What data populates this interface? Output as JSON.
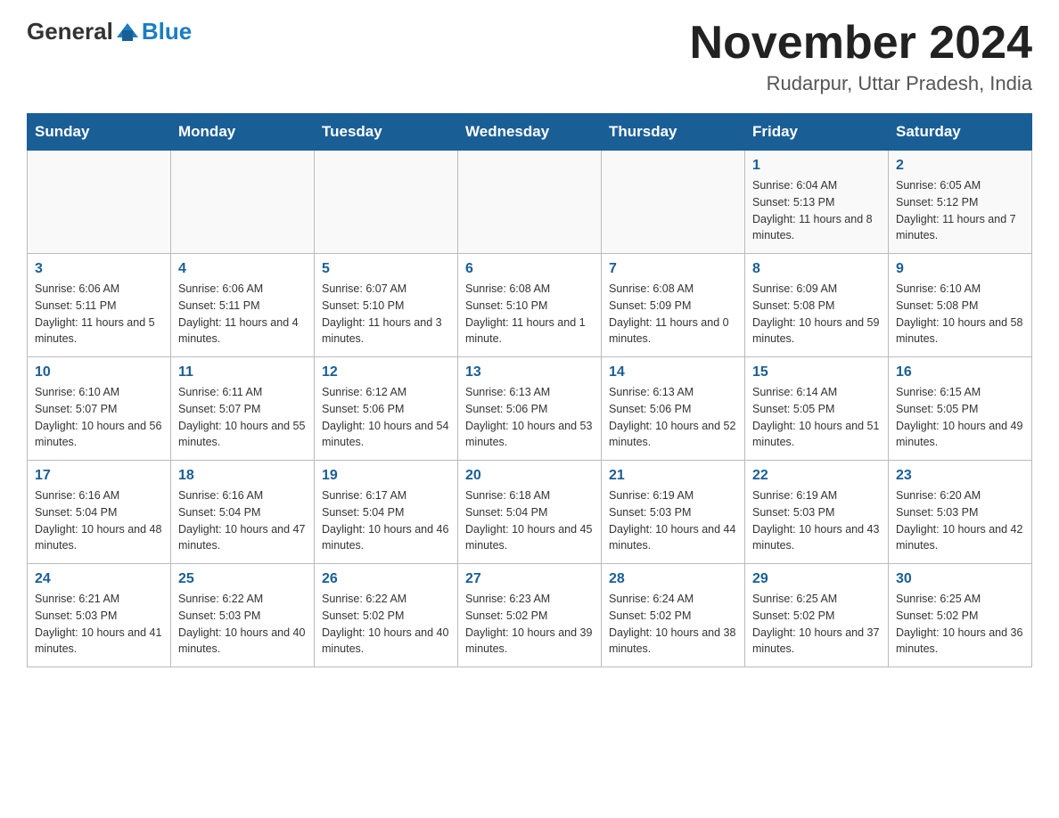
{
  "header": {
    "logo_general": "General",
    "logo_blue": "Blue",
    "month_title": "November 2024",
    "location": "Rudarpur, Uttar Pradesh, India"
  },
  "weekdays": [
    "Sunday",
    "Monday",
    "Tuesday",
    "Wednesday",
    "Thursday",
    "Friday",
    "Saturday"
  ],
  "weeks": [
    [
      {
        "day": "",
        "info": ""
      },
      {
        "day": "",
        "info": ""
      },
      {
        "day": "",
        "info": ""
      },
      {
        "day": "",
        "info": ""
      },
      {
        "day": "",
        "info": ""
      },
      {
        "day": "1",
        "info": "Sunrise: 6:04 AM\nSunset: 5:13 PM\nDaylight: 11 hours and 8 minutes."
      },
      {
        "day": "2",
        "info": "Sunrise: 6:05 AM\nSunset: 5:12 PM\nDaylight: 11 hours and 7 minutes."
      }
    ],
    [
      {
        "day": "3",
        "info": "Sunrise: 6:06 AM\nSunset: 5:11 PM\nDaylight: 11 hours and 5 minutes."
      },
      {
        "day": "4",
        "info": "Sunrise: 6:06 AM\nSunset: 5:11 PM\nDaylight: 11 hours and 4 minutes."
      },
      {
        "day": "5",
        "info": "Sunrise: 6:07 AM\nSunset: 5:10 PM\nDaylight: 11 hours and 3 minutes."
      },
      {
        "day": "6",
        "info": "Sunrise: 6:08 AM\nSunset: 5:10 PM\nDaylight: 11 hours and 1 minute."
      },
      {
        "day": "7",
        "info": "Sunrise: 6:08 AM\nSunset: 5:09 PM\nDaylight: 11 hours and 0 minutes."
      },
      {
        "day": "8",
        "info": "Sunrise: 6:09 AM\nSunset: 5:08 PM\nDaylight: 10 hours and 59 minutes."
      },
      {
        "day": "9",
        "info": "Sunrise: 6:10 AM\nSunset: 5:08 PM\nDaylight: 10 hours and 58 minutes."
      }
    ],
    [
      {
        "day": "10",
        "info": "Sunrise: 6:10 AM\nSunset: 5:07 PM\nDaylight: 10 hours and 56 minutes."
      },
      {
        "day": "11",
        "info": "Sunrise: 6:11 AM\nSunset: 5:07 PM\nDaylight: 10 hours and 55 minutes."
      },
      {
        "day": "12",
        "info": "Sunrise: 6:12 AM\nSunset: 5:06 PM\nDaylight: 10 hours and 54 minutes."
      },
      {
        "day": "13",
        "info": "Sunrise: 6:13 AM\nSunset: 5:06 PM\nDaylight: 10 hours and 53 minutes."
      },
      {
        "day": "14",
        "info": "Sunrise: 6:13 AM\nSunset: 5:06 PM\nDaylight: 10 hours and 52 minutes."
      },
      {
        "day": "15",
        "info": "Sunrise: 6:14 AM\nSunset: 5:05 PM\nDaylight: 10 hours and 51 minutes."
      },
      {
        "day": "16",
        "info": "Sunrise: 6:15 AM\nSunset: 5:05 PM\nDaylight: 10 hours and 49 minutes."
      }
    ],
    [
      {
        "day": "17",
        "info": "Sunrise: 6:16 AM\nSunset: 5:04 PM\nDaylight: 10 hours and 48 minutes."
      },
      {
        "day": "18",
        "info": "Sunrise: 6:16 AM\nSunset: 5:04 PM\nDaylight: 10 hours and 47 minutes."
      },
      {
        "day": "19",
        "info": "Sunrise: 6:17 AM\nSunset: 5:04 PM\nDaylight: 10 hours and 46 minutes."
      },
      {
        "day": "20",
        "info": "Sunrise: 6:18 AM\nSunset: 5:04 PM\nDaylight: 10 hours and 45 minutes."
      },
      {
        "day": "21",
        "info": "Sunrise: 6:19 AM\nSunset: 5:03 PM\nDaylight: 10 hours and 44 minutes."
      },
      {
        "day": "22",
        "info": "Sunrise: 6:19 AM\nSunset: 5:03 PM\nDaylight: 10 hours and 43 minutes."
      },
      {
        "day": "23",
        "info": "Sunrise: 6:20 AM\nSunset: 5:03 PM\nDaylight: 10 hours and 42 minutes."
      }
    ],
    [
      {
        "day": "24",
        "info": "Sunrise: 6:21 AM\nSunset: 5:03 PM\nDaylight: 10 hours and 41 minutes."
      },
      {
        "day": "25",
        "info": "Sunrise: 6:22 AM\nSunset: 5:03 PM\nDaylight: 10 hours and 40 minutes."
      },
      {
        "day": "26",
        "info": "Sunrise: 6:22 AM\nSunset: 5:02 PM\nDaylight: 10 hours and 40 minutes."
      },
      {
        "day": "27",
        "info": "Sunrise: 6:23 AM\nSunset: 5:02 PM\nDaylight: 10 hours and 39 minutes."
      },
      {
        "day": "28",
        "info": "Sunrise: 6:24 AM\nSunset: 5:02 PM\nDaylight: 10 hours and 38 minutes."
      },
      {
        "day": "29",
        "info": "Sunrise: 6:25 AM\nSunset: 5:02 PM\nDaylight: 10 hours and 37 minutes."
      },
      {
        "day": "30",
        "info": "Sunrise: 6:25 AM\nSunset: 5:02 PM\nDaylight: 10 hours and 36 minutes."
      }
    ]
  ]
}
